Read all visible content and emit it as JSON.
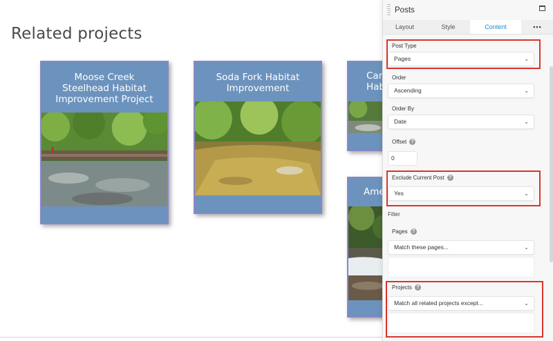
{
  "page": {
    "title": "Related projects"
  },
  "cards": [
    {
      "title": "Moose Creek Steelhead Habitat Improvement Project"
    },
    {
      "title": "Soda Fork Habitat Improvement"
    },
    {
      "title_line1": "Canv",
      "title_line2": "Hab"
    },
    {
      "title": "Ames"
    }
  ],
  "panel": {
    "title": "Posts",
    "tabs": [
      "Layout",
      "Style",
      "Content",
      "•••"
    ],
    "active_tab": "Content",
    "post_type": {
      "label": "Post Type",
      "value": "Pages"
    },
    "order": {
      "label": "Order",
      "value": "Ascending"
    },
    "order_by": {
      "label": "Order By",
      "value": "Date"
    },
    "offset": {
      "label": "Offset",
      "value": "0"
    },
    "exclude_current": {
      "label": "Exclude Current Post",
      "value": "Yes"
    },
    "filter_heading": "Filter",
    "pages_filter": {
      "label": "Pages",
      "value": "Match these pages..."
    },
    "projects_filter": {
      "label": "Projects",
      "value": "Match all related projects except..."
    },
    "help_glyph": "?",
    "chevron": "⌄"
  },
  "colors": {
    "card_bg": "#6c93bd",
    "card_border": "#8a86c8",
    "accent_tab": "#1a8cc8",
    "highlight": "#d9332b"
  }
}
